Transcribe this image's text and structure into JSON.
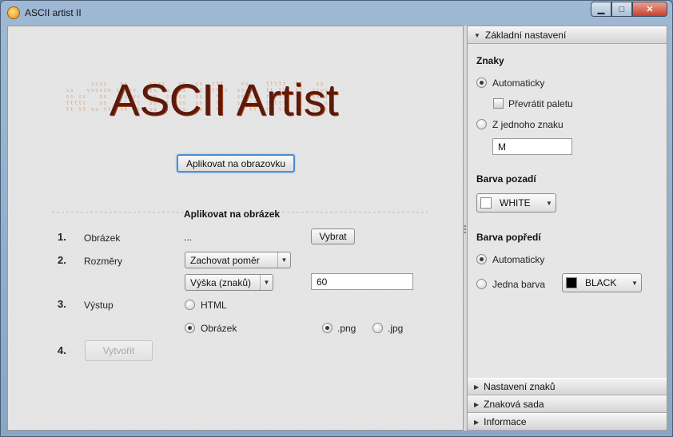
{
  "window": {
    "title": "ASCII artist II",
    "minimize_label": "▁",
    "maximize_label": "□",
    "close_label": "✕"
  },
  "logo": {
    "title": "ASCII Artist",
    "ascii_text": "        ssss   ss     ssss   ss  ss  ttt    ss    ttttt  tt   ss\n  ss   vvssss ss|vv   ss ss  ss  ss  ttvv  ssvv   tt tt  tt  ssvv\n  ss ss   ss   ss|vv  ss  ss ss  ss   tt   ss ss  tt tt  tt  ss ss\n  ttttt   ss   ss tt  ss tt  ss  ss   tt   ss ss  ttttt  tt  ss ss\n  tt tt ss tt  tt tt  ss tt  ss  ss   tt   ss tt  tt tt  tt  tt tt"
  },
  "left": {
    "apply_screen_button": "Aplikovat na obrazovku",
    "apply_image_heading": "Aplikovat na obrázek",
    "steps": [
      {
        "num": "1.",
        "label": "Obrázek"
      },
      {
        "num": "2.",
        "label": "Rozměry"
      },
      {
        "num": "3.",
        "label": "Výstup"
      },
      {
        "num": "4.",
        "label": ""
      }
    ],
    "image_path": "...",
    "choose_button": "Vybrat",
    "ratio_select": "Zachovat poměr",
    "height_select": "Výška (znaků)",
    "height_value": "60",
    "output_html": "HTML",
    "output_image": "Obrázek",
    "format_png": ".png",
    "format_jpg": ".jpg",
    "create_button": "Vytvořit"
  },
  "right": {
    "basic_header": "Základní nastavení",
    "chars_title": "Znaky",
    "auto_label": "Automaticky",
    "invert_palette_label": "Převrátit paletu",
    "single_char_label": "Z jednoho znaku",
    "single_char_value": "M",
    "bg_title": "Barva pozadí",
    "bg_color_name": "WHITE",
    "bg_color_hex": "#ffffff",
    "fg_title": "Barva popředí",
    "fg_auto_label": "Automaticky",
    "fg_single_label": "Jedna barva",
    "fg_color_name": "BLACK",
    "fg_color_hex": "#000000",
    "collapsed_headers": [
      "Nastavení znaků",
      "Znaková sada",
      "Informace"
    ]
  }
}
